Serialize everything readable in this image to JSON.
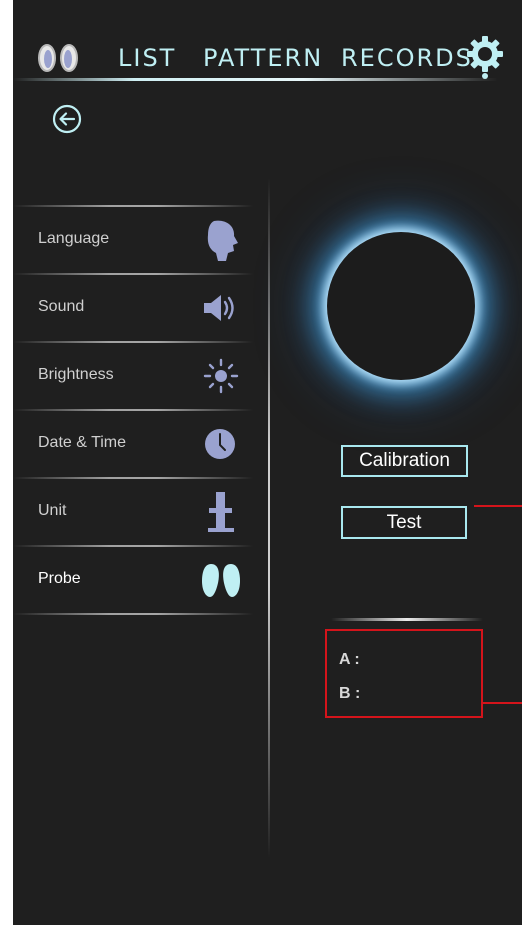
{
  "header": {
    "tabs": [
      {
        "label": "LIST"
      },
      {
        "label": "PATTERN"
      },
      {
        "label": "RECORDS"
      }
    ],
    "logo_icon": "probe-pair-icon",
    "settings_icon": "gear-icon",
    "back_icon": "back-arrow-icon"
  },
  "sidebar": {
    "items": [
      {
        "label": "Language",
        "icon": "head-profile-icon"
      },
      {
        "label": "Sound",
        "icon": "speaker-icon"
      },
      {
        "label": "Brightness",
        "icon": "sun-icon"
      },
      {
        "label": "Date & Time",
        "icon": "clock-icon"
      },
      {
        "label": "Unit",
        "icon": "height-scale-icon"
      },
      {
        "label": "Probe",
        "icon": "probe-icon",
        "active": true
      }
    ]
  },
  "probe_panel": {
    "calibration_label": "Calibration",
    "test_label": "Test",
    "reading_a_label": "A :",
    "reading_b_label": "B :"
  },
  "colors": {
    "background": "#1f1f1f",
    "accent": "#a9e8ef",
    "icon": "#9aa2cf",
    "annotation": "#d4141b"
  }
}
